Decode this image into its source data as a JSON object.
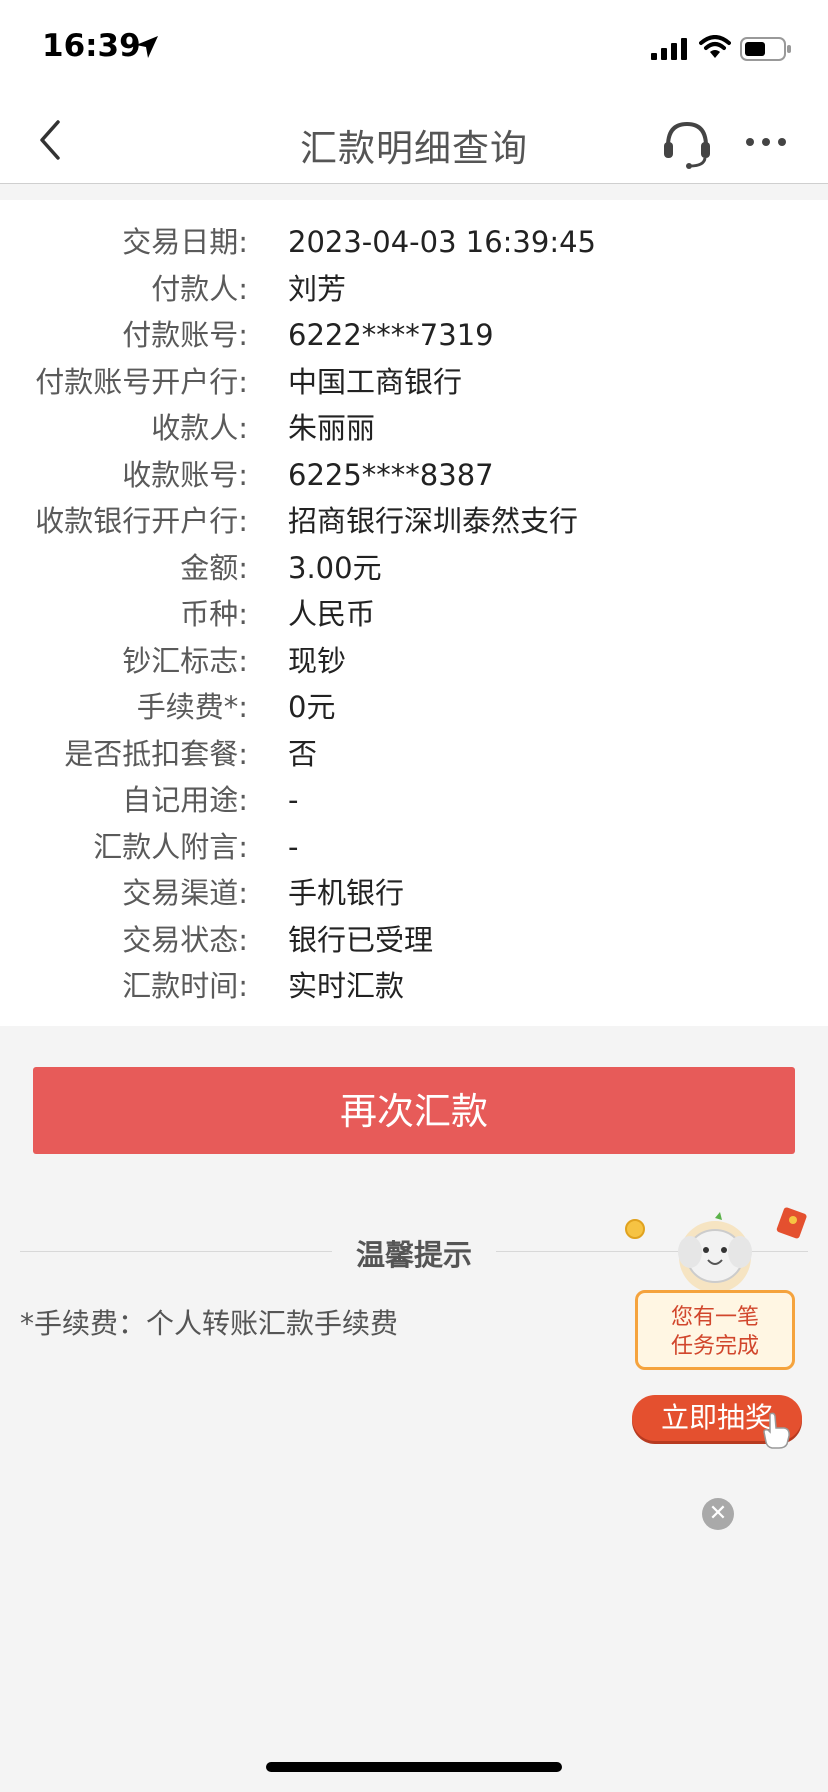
{
  "status_bar": {
    "time": "16:39",
    "icons": [
      "location-arrow-icon",
      "signal-icon",
      "wifi-icon",
      "battery-icon"
    ]
  },
  "nav": {
    "title": "汇款明细查询",
    "back_icon": "chevron-left-icon",
    "service_icon": "headset-icon",
    "more_icon": "more-dots-icon"
  },
  "details": [
    {
      "label": "交易日期:",
      "value": "2023-04-03 16:39:45"
    },
    {
      "label": "付款人:",
      "value": "刘芳"
    },
    {
      "label": "付款账号:",
      "value": "6222****7319"
    },
    {
      "label": "付款账号开户行:",
      "value": "中国工商银行"
    },
    {
      "label": "收款人:",
      "value": "朱丽丽"
    },
    {
      "label": "收款账号:",
      "value": "6225****8387"
    },
    {
      "label": "收款银行开户行:",
      "value": "招商银行深圳泰然支行"
    },
    {
      "label": "金额:",
      "value": "3.00元"
    },
    {
      "label": "币种:",
      "value": "人民币"
    },
    {
      "label": "钞汇标志:",
      "value": "现钞"
    },
    {
      "label": "手续费*:",
      "value": "0元"
    },
    {
      "label": "是否抵扣套餐:",
      "value": "否"
    },
    {
      "label": "自记用途:",
      "value": "-"
    },
    {
      "label": "汇款人附言:",
      "value": "-"
    },
    {
      "label": "交易渠道:",
      "value": "手机银行"
    },
    {
      "label": "交易状态:",
      "value": "银行已受理"
    },
    {
      "label": "汇款时间:",
      "value": "实时汇款"
    }
  ],
  "actions": {
    "remit_again": "再次汇款"
  },
  "tips": {
    "title": "温馨提示",
    "text": "*手续费：个人转账汇款手续费"
  },
  "promo": {
    "line1": "您有一笔",
    "line2": "任务完成",
    "button": "立即抽奖",
    "close_icon": "close-icon",
    "accent": "#e4502f"
  },
  "colors": {
    "primary_button": "#e75b59",
    "background": "#f4f4f4"
  }
}
